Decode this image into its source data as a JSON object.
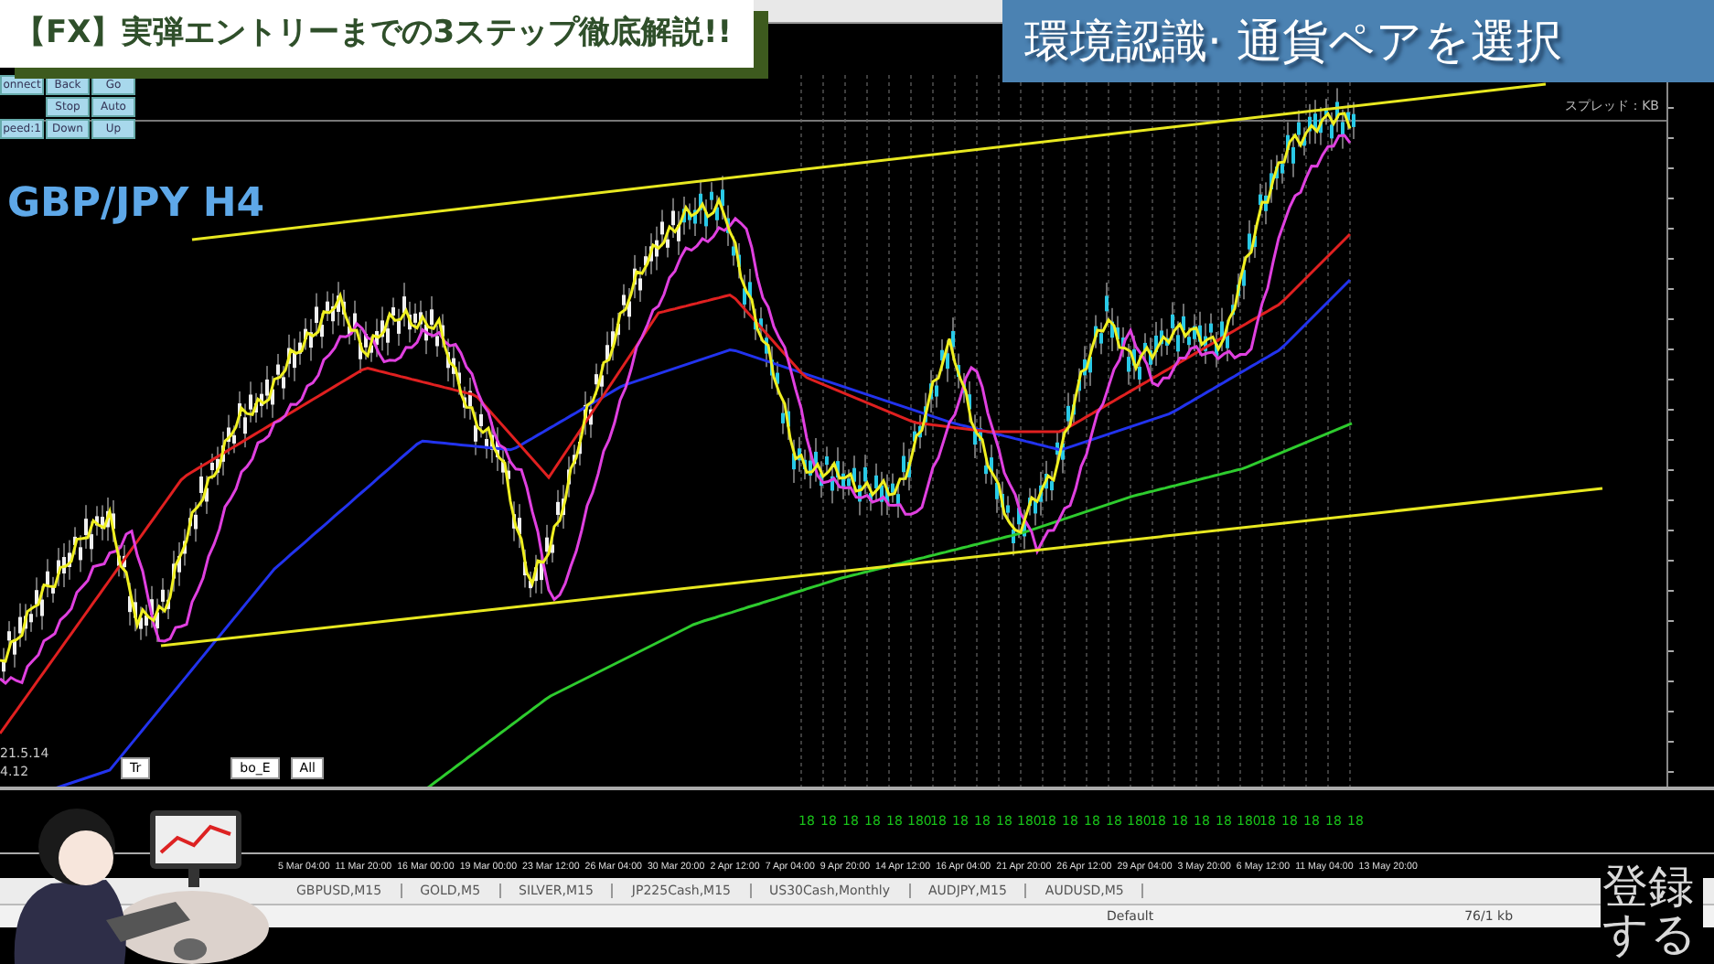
{
  "header_banner": {
    "title": "【FX】実弾エントリーまでの3ステップ徹底解説!!"
  },
  "step_banner": {
    "title": "環境認識· 通貨ペアを選択"
  },
  "control_panel": {
    "rows": [
      [
        "onnect",
        "Back",
        "Go"
      ],
      [
        "",
        "Stop",
        "Auto"
      ],
      [
        "peed:1",
        "Down",
        "Up"
      ]
    ]
  },
  "chart": {
    "symbol": "GBP/JPY H4",
    "info_lines": [
      "21.5.14",
      "4.12"
    ],
    "corner_text": "スプレッド：KB",
    "object_buttons": [
      "Tr",
      "bo_E",
      "All"
    ]
  },
  "indicator_labels": [
    "18",
    "18",
    "18",
    "18",
    "18",
    "180",
    "18",
    "18",
    "18",
    "18",
    "180",
    "18",
    "18",
    "18",
    "18",
    "180",
    "18",
    "18",
    "18",
    "18",
    "180",
    "18",
    "18",
    "18",
    "18",
    "18"
  ],
  "time_axis": [
    "5 Mar 04:00",
    "11 Mar 20:00",
    "16 Mar 00:00",
    "19 Mar 00:00",
    "23 Mar 12:00",
    "26 Mar 04:00",
    "30 Mar 20:00",
    "2 Apr 12:00",
    "7 Apr 04:00",
    "9 Apr 20:00",
    "14 Apr 12:00",
    "16 Apr 04:00",
    "21 Apr 20:00",
    "26 Apr 12:00",
    "29 Apr 04:00",
    "3 May 20:00",
    "6 May 12:00",
    "11 May 04:00",
    "13 May 20:00"
  ],
  "tabs": [
    {
      "label": "GBPUSD,M15"
    },
    {
      "label": "GOLD,M5"
    },
    {
      "label": "SILVER,M15"
    },
    {
      "label": "JP225Cash,M15"
    },
    {
      "label": "US30Cash,Monthly"
    },
    {
      "label": "AUDJPY,M15"
    },
    {
      "label": "AUDUSD,M5"
    }
  ],
  "status_bar": {
    "profile": "Default",
    "traffic": "76/1 kb"
  },
  "subscribe_overlay": {
    "text": "登録する"
  }
}
